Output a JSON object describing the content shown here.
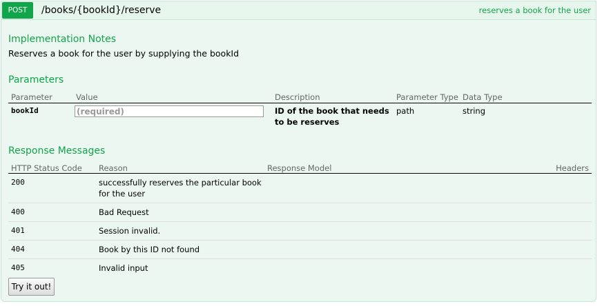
{
  "operation": {
    "method": "POST",
    "path": "/books/{bookId}/reserve",
    "summary": "reserves a book for the user"
  },
  "implementation": {
    "title": "Implementation Notes",
    "text": "Reserves a book for the user by supplying the bookId"
  },
  "parameters": {
    "title": "Parameters",
    "headers": [
      "Parameter",
      "Value",
      "Description",
      "Parameter Type",
      "Data Type"
    ],
    "rows": [
      {
        "name": "bookId",
        "placeholder": "(required)",
        "description": "ID of the book that needs to be reserves",
        "param_type": "path",
        "data_type": "string"
      }
    ]
  },
  "responses": {
    "title": "Response Messages",
    "headers": [
      "HTTP Status Code",
      "Reason",
      "Response Model",
      "Headers"
    ],
    "rows": [
      {
        "code": "200",
        "reason": "successfully reserves the particular book for the user"
      },
      {
        "code": "400",
        "reason": "Bad Request"
      },
      {
        "code": "401",
        "reason": "Session invalid."
      },
      {
        "code": "404",
        "reason": "Book by this ID not found"
      },
      {
        "code": "405",
        "reason": "Invalid input"
      }
    ]
  },
  "try_button": "Try it out!",
  "colors": {
    "method_bg": "#10a54a",
    "section_title": "#10a54a",
    "panel_bg": "#ebf7f0",
    "panel_border": "#c3e8d1"
  }
}
